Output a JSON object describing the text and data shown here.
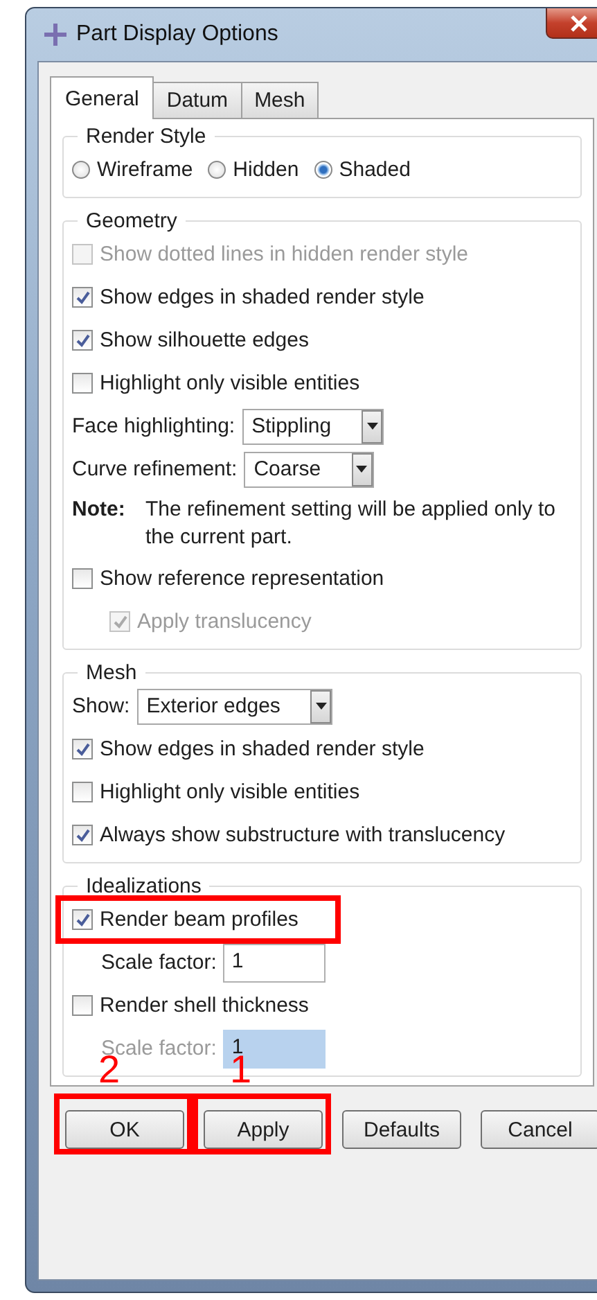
{
  "window": {
    "title": "Part Display Options"
  },
  "tabs": [
    {
      "label": "General",
      "selected": true
    },
    {
      "label": "Datum",
      "selected": false
    },
    {
      "label": "Mesh",
      "selected": false
    }
  ],
  "groups": [
    {
      "title": "Render Style",
      "rows": [
        {
          "kind": "radio",
          "options": [
            {
              "label": "Wireframe",
              "selected": false
            },
            {
              "label": "Hidden",
              "selected": false
            },
            {
              "label": "Shaded",
              "selected": true
            }
          ]
        }
      ]
    },
    {
      "title": "Geometry",
      "rows": [
        {
          "kind": "checkbox",
          "label": "Show dotted lines in hidden render style",
          "checked": false,
          "disabled": true
        },
        {
          "kind": "checkbox",
          "label": "Show edges in shaded render style",
          "checked": true,
          "disabled": false
        },
        {
          "kind": "checkbox",
          "label": "Show silhouette edges",
          "checked": true,
          "disabled": false
        },
        {
          "kind": "checkbox",
          "label": "Highlight only visible entities",
          "checked": false,
          "disabled": false
        },
        {
          "kind": "dropdown",
          "label": "Face highlighting:",
          "value": "Stippling"
        },
        {
          "kind": "dropdown",
          "label": "Curve refinement:",
          "value": "Coarse"
        },
        {
          "kind": "note",
          "label": "Note:",
          "text": "The refinement setting will be applied only to the current part."
        },
        {
          "kind": "checkbox",
          "label": "Show reference representation",
          "checked": false,
          "disabled": false,
          "children": [
            {
              "kind": "checkbox",
              "label": "Apply translucency",
              "checked": true,
              "disabled": true
            }
          ]
        }
      ]
    },
    {
      "title": "Mesh",
      "rows": [
        {
          "kind": "dropdown",
          "label": "Show:",
          "value": "Exterior edges"
        },
        {
          "kind": "checkbox",
          "label": "Show edges in shaded render style",
          "checked": true,
          "disabled": false
        },
        {
          "kind": "checkbox",
          "label": "Highlight only visible entities",
          "checked": false,
          "disabled": false
        },
        {
          "kind": "checkbox",
          "label": "Always show substructure with translucency",
          "checked": true,
          "disabled": false
        }
      ]
    },
    {
      "title": "Idealizations",
      "rows": [
        {
          "kind": "checkbox",
          "label": "Render beam profiles",
          "checked": true,
          "disabled": false,
          "highlighted": true,
          "children": [
            {
              "kind": "field",
              "label": "Scale factor:",
              "value": "1",
              "disabled": false
            }
          ]
        },
        {
          "kind": "checkbox",
          "label": "Render shell thickness",
          "checked": false,
          "disabled": false,
          "children": [
            {
              "kind": "field",
              "label": "Scale factor:",
              "value": "1",
              "disabled": true
            }
          ]
        }
      ]
    }
  ],
  "buttons": [
    {
      "label": "OK",
      "highlighted": true,
      "callout": "2"
    },
    {
      "label": "Apply",
      "highlighted": true,
      "callout": "1"
    },
    {
      "label": "Defaults",
      "highlighted": false
    },
    {
      "label": "Cancel",
      "highlighted": false
    }
  ]
}
